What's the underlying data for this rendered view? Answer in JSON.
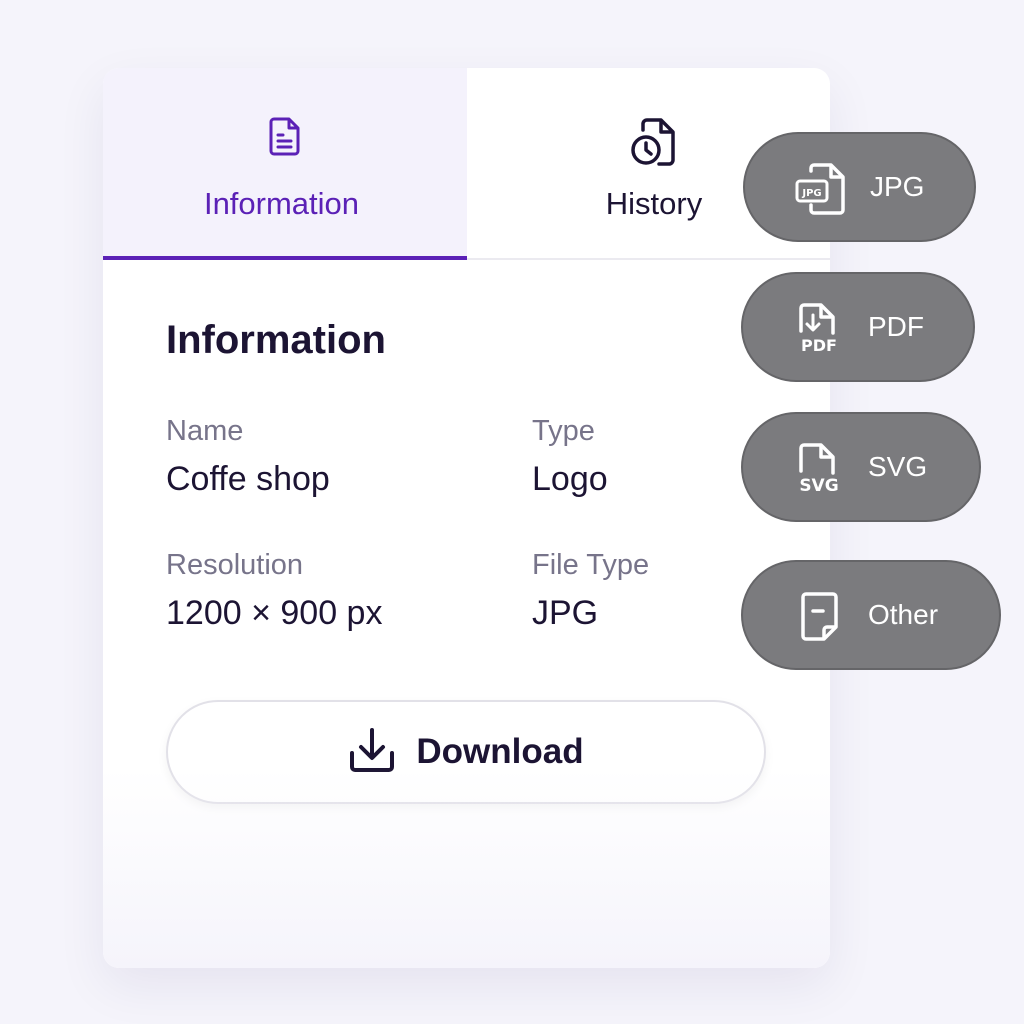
{
  "tabs": [
    {
      "label": "Information",
      "icon": "document-icon",
      "active": true
    },
    {
      "label": "History",
      "icon": "file-clock-icon",
      "active": false
    }
  ],
  "info": {
    "title": "Information",
    "fields": [
      {
        "label": "Name",
        "value": "Coffe shop"
      },
      {
        "label": "Type",
        "value": "Logo"
      },
      {
        "label": "Resolution",
        "value": "1200 × 900 px"
      },
      {
        "label": "File Type",
        "value": "JPG"
      }
    ]
  },
  "download": {
    "label": "Download",
    "icon": "download-icon"
  },
  "formats": [
    {
      "label": "JPG",
      "icon": "jpg-file-icon"
    },
    {
      "label": "PDF",
      "icon": "pdf-file-icon"
    },
    {
      "label": "SVG",
      "icon": "svg-file-icon"
    },
    {
      "label": "Other",
      "icon": "generic-file-icon"
    }
  ],
  "colors": {
    "accent": "#5b21b6",
    "text": "#1c1433",
    "muted": "#77748a",
    "pill": "#7b7b7e",
    "background": "#f5f4fb"
  }
}
